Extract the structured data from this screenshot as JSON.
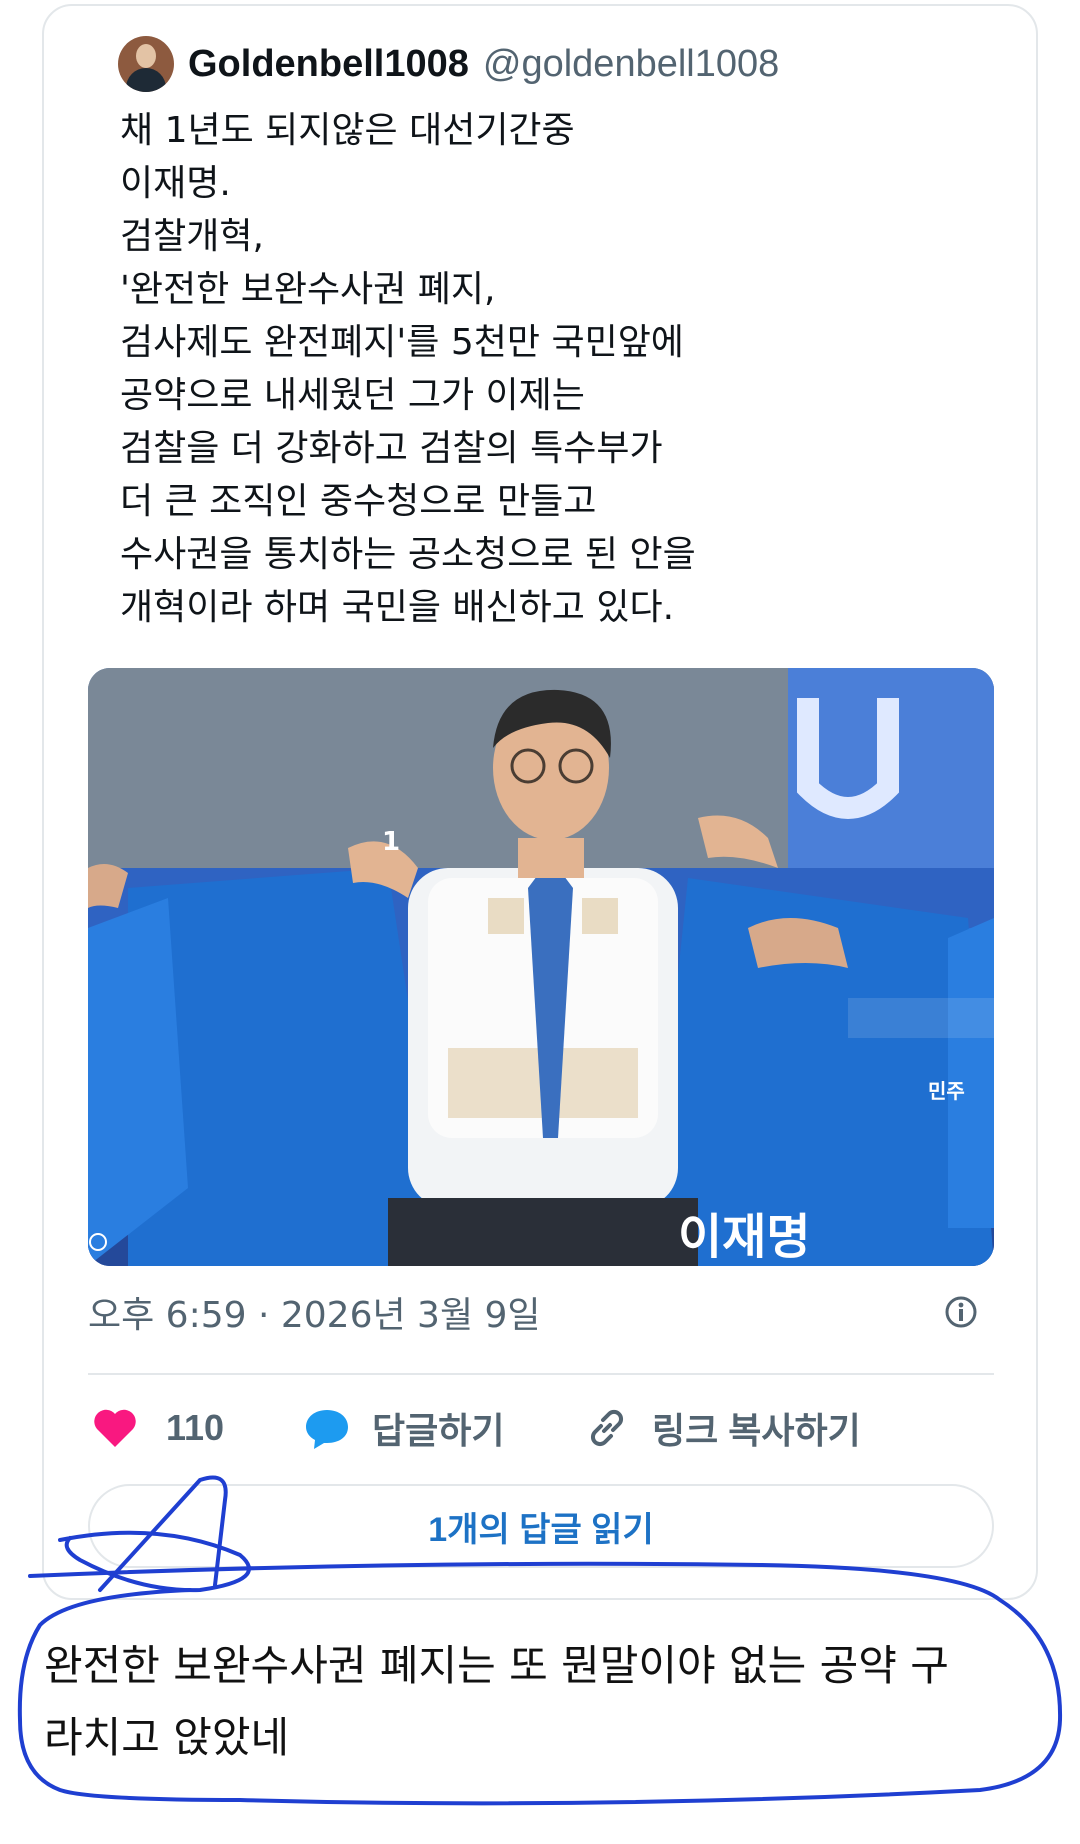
{
  "tweet": {
    "author": {
      "display_name": "Goldenbell1008",
      "handle": "@goldenbell1008",
      "avatar_icon": "avatar"
    },
    "text_lines": [
      "채 1년도 되지않은 대선기간중",
      "이재명.",
      "검찰개혁,",
      "'완전한 보완수사권 폐지,",
      "검사제도 완전폐지'를 5천만 국민앞에",
      "공약으로 내세웠던 그가 이제는",
      "검찰을 더 강화하고 검찰의 특수부가",
      "더 큰 조직인 중수청으로 만들고",
      "수사권을 통치하는 공소청으로 된 안을",
      "개혁이라 하며 국민을 배신하고 있다."
    ],
    "photo": {
      "sign_text": "이재명",
      "party_mark": "민주",
      "cap_number": "1"
    },
    "timestamp": "오후 6:59 · 2026년 3월 9일",
    "actions": {
      "like_count": "110",
      "reply_label": "답글하기",
      "copy_link_label": "링크 복사하기"
    },
    "read_replies_label": "1개의 답글 읽기"
  },
  "comment": {
    "lines": [
      "완전한 보완수사권 폐지는 또 뭔말이야 없는 공약 구",
      "라치고 앉았네"
    ]
  },
  "colors": {
    "like_heart": "#f91880",
    "reply_bubble": "#1d9bf0",
    "link_text": "#1d72c5",
    "secondary_text": "#536471",
    "annotation_ink": "#1f3fd1"
  },
  "icons": [
    "info-icon",
    "heart-icon",
    "reply-bubble-icon",
    "link-icon"
  ]
}
